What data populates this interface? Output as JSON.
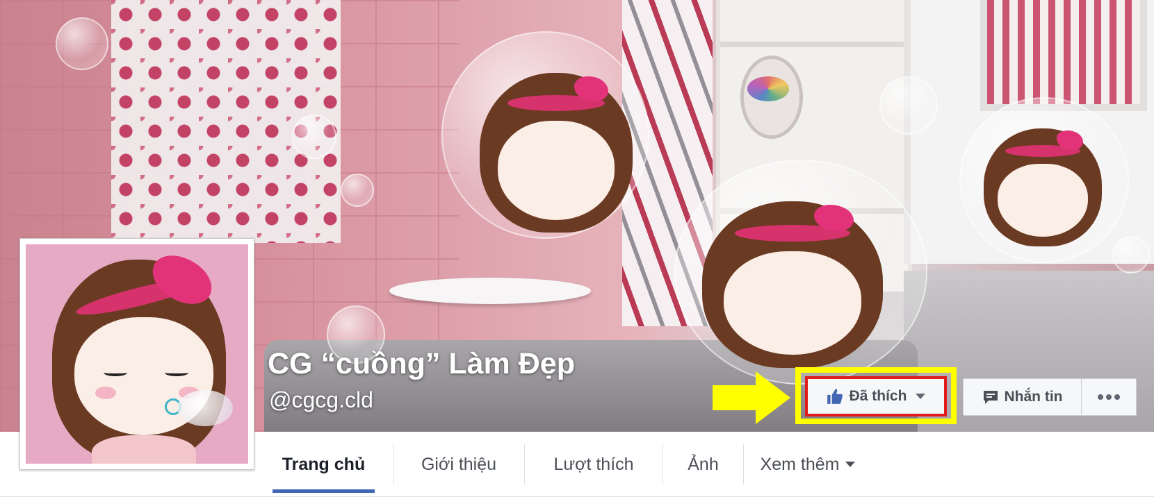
{
  "page": {
    "name": "CG “cuồng” Làm Đẹp",
    "handle": "@cgcg.cld"
  },
  "actions": {
    "like_label": "Đã thích",
    "message_label": "Nhắn tin"
  },
  "tabs": [
    {
      "label": "Trang chủ",
      "active": true
    },
    {
      "label": "Giới thiệu",
      "active": false
    },
    {
      "label": "Lượt thích",
      "active": false
    },
    {
      "label": "Ảnh",
      "active": false
    },
    {
      "label": "Xem thêm",
      "active": false
    }
  ],
  "icons": {
    "like": "thumbs-up-icon",
    "like_dropdown": "caret-down-icon",
    "message": "chat-bubble-icon",
    "more": "more-dots-icon",
    "see_more_dropdown": "caret-down-icon",
    "annotation": "yellow-arrow-icon"
  },
  "colors": {
    "highlight_outer": "#ffff00",
    "highlight_inner": "#e01b1b",
    "facebook_blue": "#4267b2",
    "tab_text": "#4b4f56"
  }
}
